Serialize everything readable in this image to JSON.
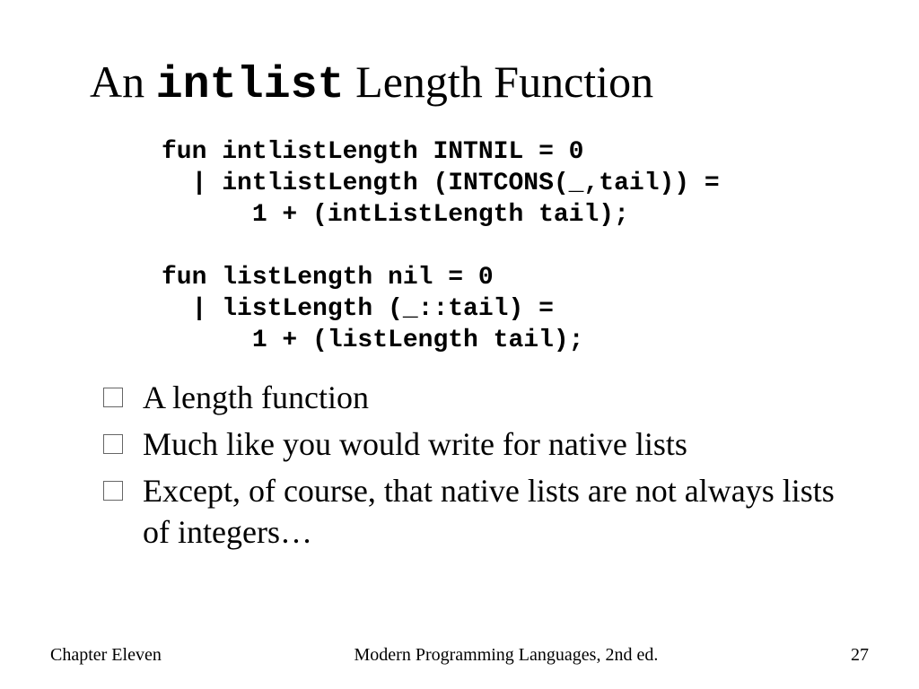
{
  "title": {
    "prefix": "An ",
    "mono": "intlist",
    "suffix": " Length Function"
  },
  "code": {
    "line1": "fun intlistLength INTNIL = 0",
    "line2": "  | intlistLength (INTCONS(_,tail)) =",
    "line3": "      1 + (intListLength tail);",
    "line4": "",
    "line5": "fun listLength nil = 0",
    "line6": "  | listLength (_::tail) =",
    "line7": "      1 + (listLength tail);"
  },
  "bullets": [
    "A length function",
    "Much like you would write for native lists",
    "Except, of course, that native lists are not always lists of integers…"
  ],
  "footer": {
    "left": "Chapter Eleven",
    "center": "Modern Programming Languages, 2nd ed.",
    "right": "27"
  }
}
